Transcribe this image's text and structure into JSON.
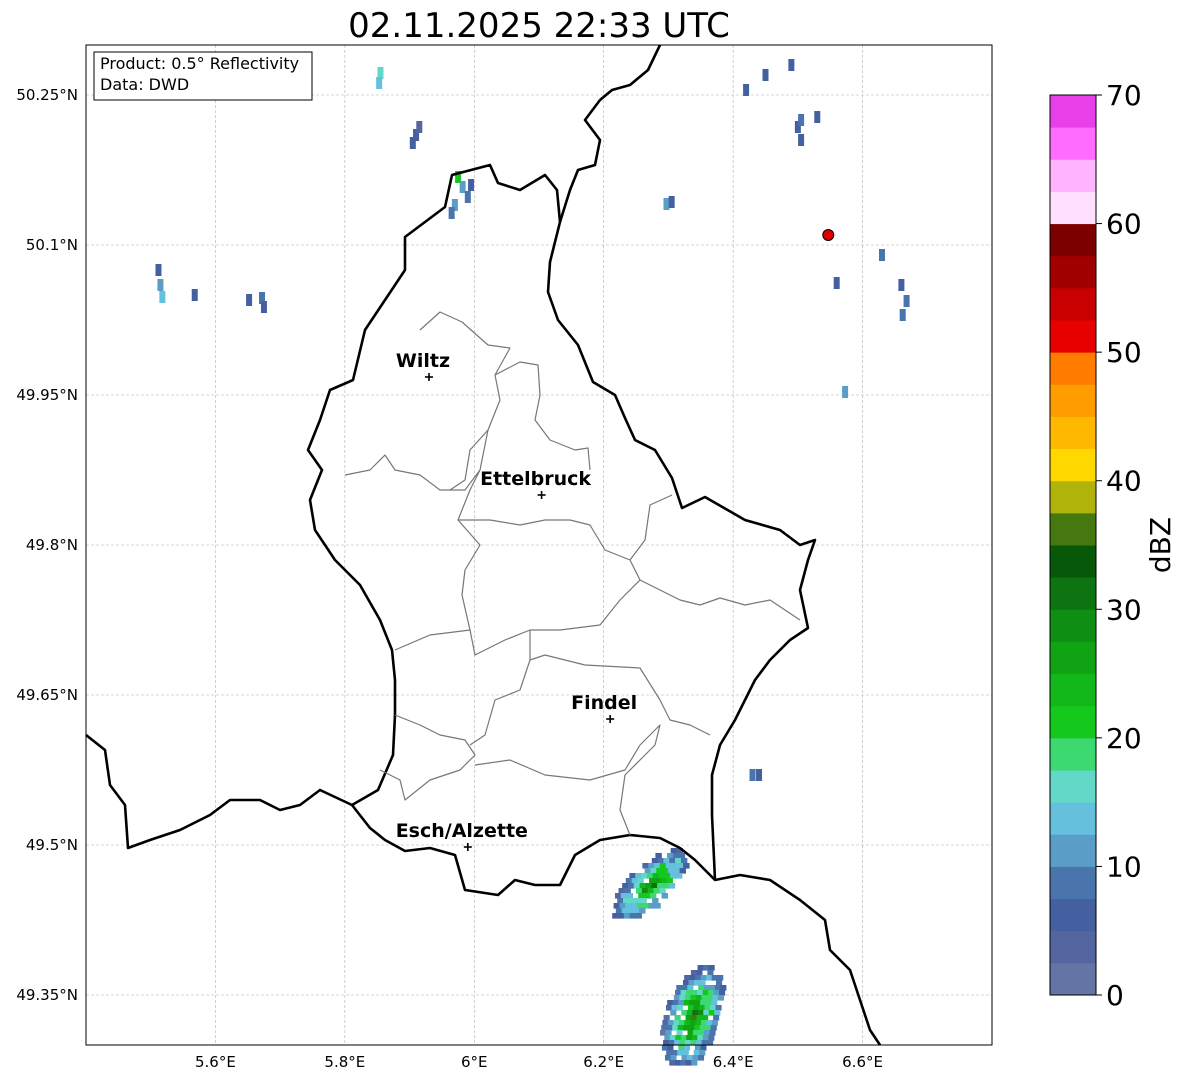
{
  "title": "02.11.2025 22:33 UTC",
  "info_box": {
    "product": "Product: 0.5° Reflectivity",
    "data": "Data: DWD"
  },
  "map": {
    "lon_range": [
      5.4,
      6.8
    ],
    "lat_range": [
      49.3,
      50.3
    ],
    "lon_ticks": [
      {
        "value": 5.6,
        "label": "5.6°E"
      },
      {
        "value": 5.8,
        "label": "5.8°E"
      },
      {
        "value": 6.0,
        "label": "6°E"
      },
      {
        "value": 6.2,
        "label": "6.2°E"
      },
      {
        "value": 6.4,
        "label": "6.4°E"
      },
      {
        "value": 6.6,
        "label": "6.6°E"
      }
    ],
    "lat_ticks": [
      {
        "value": 50.25,
        "label": "50.25°N"
      },
      {
        "value": 50.1,
        "label": "50.1°N"
      },
      {
        "value": 49.95,
        "label": "49.95°N"
      },
      {
        "value": 49.8,
        "label": "49.8°N"
      },
      {
        "value": 49.65,
        "label": "49.65°N"
      },
      {
        "value": 49.5,
        "label": "49.5°N"
      },
      {
        "value": 49.35,
        "label": "49.35°N"
      }
    ],
    "grid": true,
    "cities": [
      {
        "name": "Wiltz",
        "lon": 5.93,
        "lat": 49.968
      },
      {
        "name": "Ettelbruck",
        "lon": 6.104,
        "lat": 49.85
      },
      {
        "name": "Findel",
        "lon": 6.21,
        "lat": 49.626
      },
      {
        "name": "Esch/Alzette",
        "lon": 5.99,
        "lat": 49.498
      }
    ],
    "radar_marker": {
      "lon": 6.547,
      "lat": 50.11,
      "color": "#dd0000"
    }
  },
  "colorbar": {
    "label": "dBZ",
    "min": 0,
    "max": 70,
    "tick_values": [
      0,
      10,
      20,
      30,
      40,
      50,
      60,
      70
    ],
    "tick_labels": [
      "0",
      "10",
      "20",
      "30",
      "40",
      "50",
      "60",
      "70"
    ],
    "colors": [
      "#6474a4",
      "#5466a0",
      "#4460a0",
      "#4a74ac",
      "#5a9ec8",
      "#64c0dc",
      "#64d8c8",
      "#3cd870",
      "#14c81c",
      "#12b81a",
      "#10a414",
      "#0e8e12",
      "#0c7410",
      "#08580a",
      "#467810",
      "#b0b40a",
      "#ffd800",
      "#ffb800",
      "#ff9c00",
      "#ff7c00",
      "#e60000",
      "#c80000",
      "#a00000",
      "#7c0000",
      "#ffe0ff",
      "#ffb4ff",
      "#ff6cff",
      "#e840e8"
    ]
  },
  "echoes": [
    {
      "lon": 5.855,
      "lat": 50.272,
      "dbz": 16
    },
    {
      "lon": 5.853,
      "lat": 50.262,
      "dbz": 14
    },
    {
      "lon": 5.91,
      "lat": 50.21,
      "dbz": 6
    },
    {
      "lon": 5.915,
      "lat": 50.218,
      "dbz": 4
    },
    {
      "lon": 5.905,
      "lat": 50.202,
      "dbz": 5
    },
    {
      "lon": 5.975,
      "lat": 50.168,
      "dbz": 20
    },
    {
      "lon": 5.982,
      "lat": 50.158,
      "dbz": 10
    },
    {
      "lon": 5.99,
      "lat": 50.148,
      "dbz": 8
    },
    {
      "lon": 5.97,
      "lat": 50.14,
      "dbz": 12
    },
    {
      "lon": 5.965,
      "lat": 50.132,
      "dbz": 9
    },
    {
      "lon": 5.995,
      "lat": 50.16,
      "dbz": 6
    },
    {
      "lon": 5.512,
      "lat": 50.075,
      "dbz": 7
    },
    {
      "lon": 5.515,
      "lat": 50.06,
      "dbz": 10
    },
    {
      "lon": 5.518,
      "lat": 50.048,
      "dbz": 14
    },
    {
      "lon": 5.568,
      "lat": 50.05,
      "dbz": 6
    },
    {
      "lon": 5.652,
      "lat": 50.045,
      "dbz": 5
    },
    {
      "lon": 5.672,
      "lat": 50.047,
      "dbz": 8
    },
    {
      "lon": 5.675,
      "lat": 50.038,
      "dbz": 6
    },
    {
      "lon": 6.297,
      "lat": 50.141,
      "dbz": 12
    },
    {
      "lon": 6.305,
      "lat": 50.143,
      "dbz": 6
    },
    {
      "lon": 6.5,
      "lat": 50.218,
      "dbz": 6
    },
    {
      "lon": 6.505,
      "lat": 50.205,
      "dbz": 5
    },
    {
      "lon": 6.505,
      "lat": 50.225,
      "dbz": 8
    },
    {
      "lon": 6.53,
      "lat": 50.228,
      "dbz": 6
    },
    {
      "lon": 6.42,
      "lat": 50.255,
      "dbz": 5
    },
    {
      "lon": 6.45,
      "lat": 50.27,
      "dbz": 6
    },
    {
      "lon": 6.49,
      "lat": 50.28,
      "dbz": 5
    },
    {
      "lon": 6.63,
      "lat": 50.09,
      "dbz": 8
    },
    {
      "lon": 6.66,
      "lat": 50.06,
      "dbz": 6
    },
    {
      "lon": 6.668,
      "lat": 50.044,
      "dbz": 9
    },
    {
      "lon": 6.662,
      "lat": 50.03,
      "dbz": 8
    },
    {
      "lon": 6.56,
      "lat": 50.062,
      "dbz": 5
    },
    {
      "lon": 6.573,
      "lat": 49.953,
      "dbz": 12
    },
    {
      "lon": 6.44,
      "lat": 49.57,
      "dbz": 6
    },
    {
      "lon": 6.43,
      "lat": 49.57,
      "dbz": 8
    }
  ],
  "storm_cells": [
    {
      "lon": 6.269,
      "lat": 49.462,
      "rows": 14,
      "cols": 9,
      "dlon": 0.009,
      "dlat": 0.005,
      "peak": 31,
      "rot": -0.6
    },
    {
      "lon": 6.335,
      "lat": 49.33,
      "rows": 20,
      "cols": 10,
      "dlon": 0.0085,
      "dlat": 0.005,
      "peak": 32,
      "rot": -0.2
    }
  ]
}
